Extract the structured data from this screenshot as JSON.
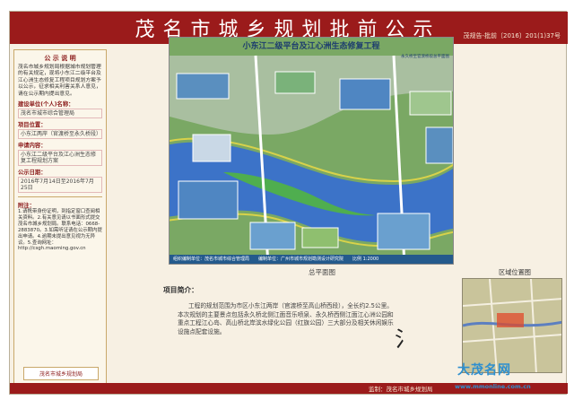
{
  "header": {
    "title": "茂名市城乡规划批前公示",
    "code": "茂规告-批前〔2016〕201(1)37号"
  },
  "sidebar": {
    "heading": "公 示 说 明",
    "body": "茂名市城乡规划局根据城市规划管理的有关规定，现将小东江二级平台及江心洲生态修复工程项目规划方案予以公示，征求相关利害关系人意见，请在公示期内提出意见。",
    "items": [
      {
        "label": "建设单位(个人)名称：",
        "value": "茂名市城市综合管理局"
      },
      {
        "label": "项目位置：",
        "value": "小东江两岸（官渡桥至永久桥段）"
      },
      {
        "label": "申请内容：",
        "value": "小东江二级平台及江心洲生态修复工程规划方案"
      },
      {
        "label": "公示日期：",
        "value": "2016年7月14日至2016年7月25日"
      }
    ],
    "notes_heading": "附注：",
    "notes": "1.请携带身份证明，到指定窗口查阅相关资料。2.有关意见请以书面形式提交茂名市城乡规划局。联系电话：0668-2883870。3.如需听证请在公示期内提出申请。4.逾期未提出意见视为无异议。5.查询网址：http://csgh.maoming.gov.cn",
    "org": "茂名市城乡规划局"
  },
  "plan": {
    "title": "小东江二级平台及江心洲生态修复工程",
    "side_label": "永久桥至官渡桥段总平面图",
    "bottom_bar": "组织编制单位：茂名市城市综合管理局　　编制单位：广州市城市规划勘测设计研究院　　比例 1:2000",
    "caption": "总平面图",
    "river_color": "#3c73c8",
    "land_color": "#6fa05a"
  },
  "intro": {
    "heading": "项目简介：",
    "text": "工程的规划范围为市区小东江两岸（官渡桥至高山桥西段），全长约2.5公里。本次规划的主要景点包括永久桥北侧江面音乐喷泉、永久桥西侧江面江心洲公园和重点工程江心岛、高山桥北岸滨水绿化公园（红旗公园）三大部分及相关休闲娱乐设施点配套设施。"
  },
  "location": {
    "heading": "区域位置图"
  },
  "footer": {
    "text": "监制：茂名市城乡规划局"
  },
  "watermark": {
    "name": "大茂名网",
    "url": "www.mmonline.com.cn"
  }
}
